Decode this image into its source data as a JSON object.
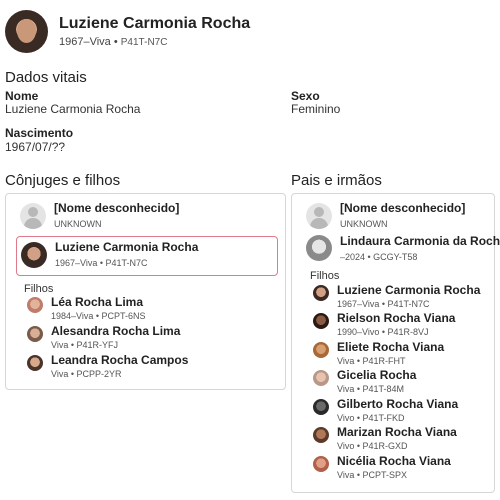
{
  "header": {
    "name": "Luziene Carmonia Rocha",
    "lifespan": "1967–Viva",
    "sep": " • ",
    "pid": "P41T-N7C"
  },
  "vital": {
    "title": "Dados vitais",
    "name_label": "Nome",
    "name_value": "Luziene Carmonia Rocha",
    "sex_label": "Sexo",
    "sex_value": "Feminino",
    "birth_label": "Nascimento",
    "birth_value": "1967/07/??"
  },
  "spouses": {
    "title": "Cônjuges e filhos",
    "unknown": {
      "name": "[Nome desconhecido]",
      "meta": "UNKNOWN"
    },
    "selected": {
      "name": "Luziene Carmonia Rocha",
      "meta": "1967–Viva • P41T-N7C"
    },
    "children_label": "Filhos",
    "children": [
      {
        "name": "Léa Rocha Lima",
        "meta": "1984–Viva • PCPT-6NS"
      },
      {
        "name": "Alesandra Rocha Lima",
        "meta": "Viva • P41R-YFJ"
      },
      {
        "name": "Leandra Rocha Campos",
        "meta": "Viva • PCPP-2YR"
      }
    ]
  },
  "parents": {
    "title": "Pais e irmãos",
    "unknown": {
      "name": "[Nome desconhecido]",
      "meta": "UNKNOWN"
    },
    "mother": {
      "name": "Lindaura Carmonia da Rocha",
      "meta": "–2024 • GCGY-T58"
    },
    "children_label": "Filhos",
    "siblings": [
      {
        "name": "Luziene Carmonia Rocha",
        "meta": "1967–Viva • P41T-N7C"
      },
      {
        "name": "Rielson Rocha Viana",
        "meta": "1990–Vivo • P41R-8VJ"
      },
      {
        "name": "Eliete Rocha Viana",
        "meta": "Viva • P41R-FHT"
      },
      {
        "name": "Gicelia Rocha",
        "meta": "Viva • P41T-84M"
      },
      {
        "name": "Gilberto Rocha Viana",
        "meta": "Vivo • P41T-FKD"
      },
      {
        "name": "Marizan Rocha Viana",
        "meta": "Vivo • P41R-GXD"
      },
      {
        "name": "Nicélia Rocha Viana",
        "meta": "Viva • PCPT-SPX"
      }
    ]
  },
  "colors": {
    "selected_border": "#e07a8a",
    "card_border": "#d6d6d6"
  }
}
